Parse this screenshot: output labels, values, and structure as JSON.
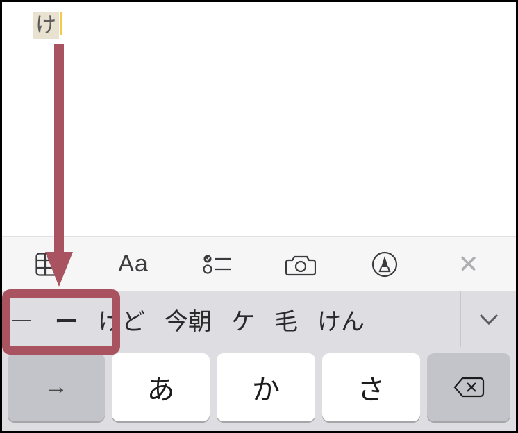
{
  "editor": {
    "typed": "け"
  },
  "toolbar": {
    "table_icon": "table-icon",
    "aa_label": "Aa",
    "checklist_icon": "checklist-icon",
    "camera_icon": "camera-icon",
    "markup_icon": "markup-icon",
    "close_label": "✕"
  },
  "suggestions": [
    "—",
    "ー",
    "けど",
    "今朝",
    "ケ",
    "毛",
    "けん"
  ],
  "keys": {
    "tab": "→",
    "k1": "あ",
    "k2": "か",
    "k3": "さ",
    "delete": "⌫"
  }
}
